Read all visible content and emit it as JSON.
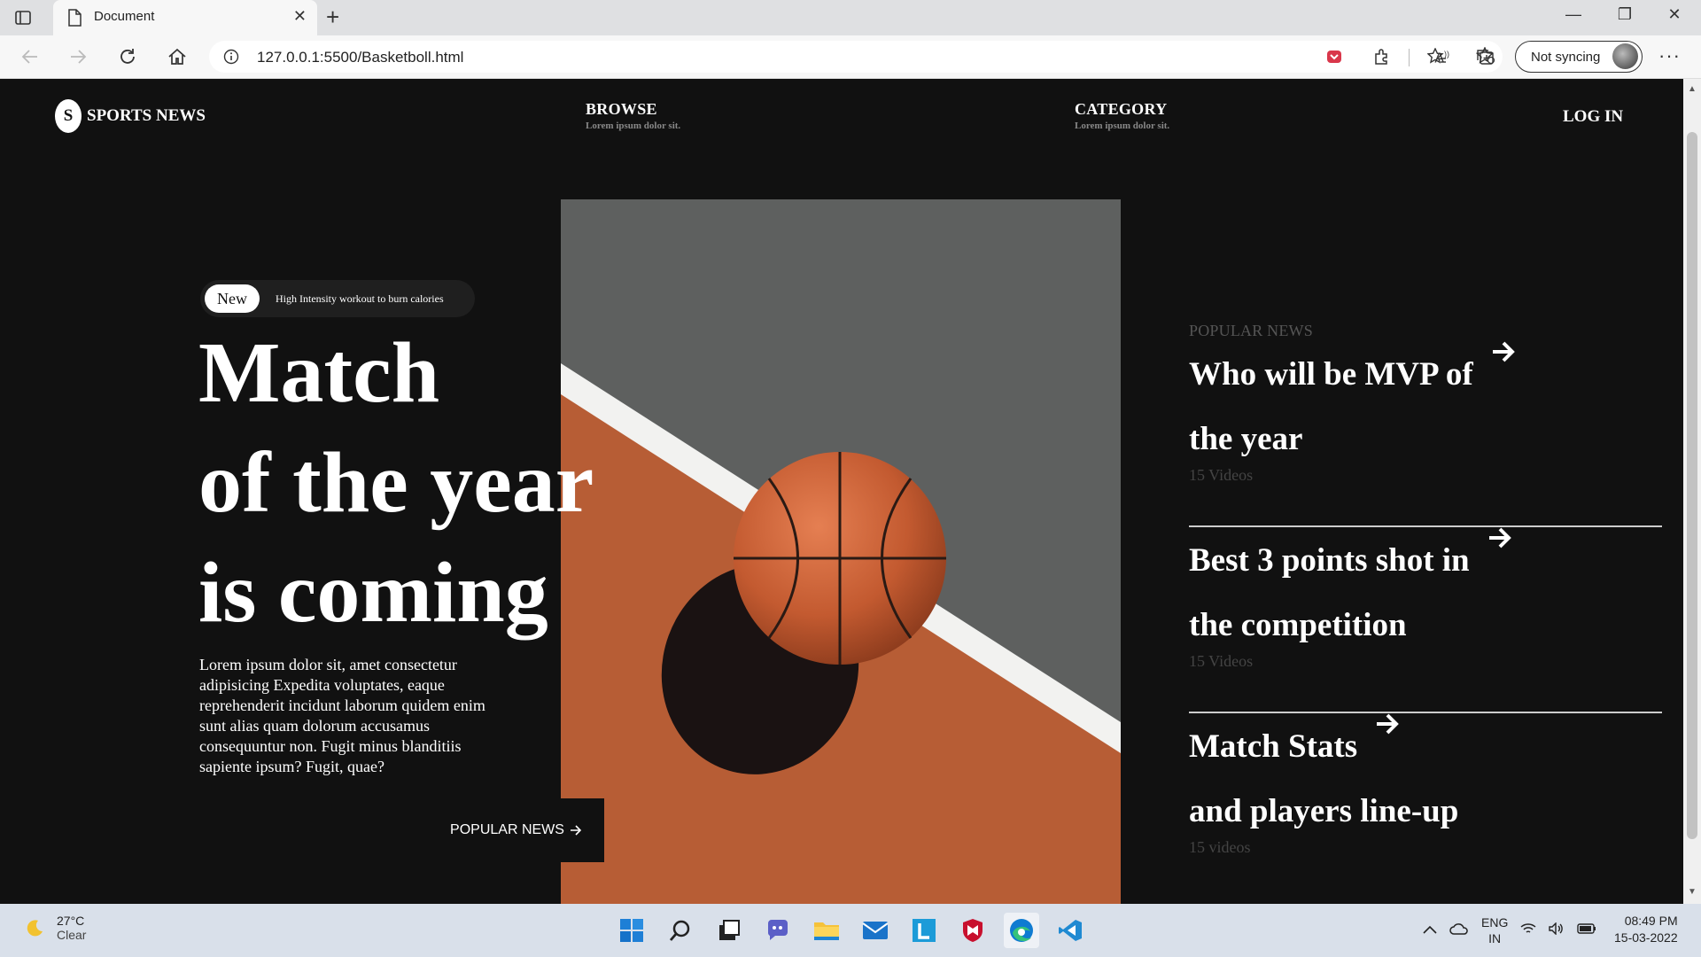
{
  "browser": {
    "tab_title": "Document",
    "url": "127.0.0.1:5500/Basketboll.html",
    "sync_label": "Not syncing"
  },
  "site": {
    "logo_letter": "S",
    "logo_text": "SPORTS NEWS",
    "nav": [
      {
        "title": "BROWSE",
        "sub": "Lorem ipsum dolor sit."
      },
      {
        "title": "CATEGORY",
        "sub": "Lorem ipsum dolor sit."
      }
    ],
    "login": "LOG IN"
  },
  "hero": {
    "badge_new": "New",
    "badge_text": "High Intensity workout to burn calories",
    "headline": [
      "Match",
      "of the year",
      "is coming"
    ],
    "lead": "Lorem ipsum dolor sit, amet consectetur adipisicing Expedita voluptates, eaque reprehenderit incidunt laborum quidem enim sunt alias quam dolorum accusamus consequuntur non. Fugit minus blanditiis sapiente ipsum? Fugit, quae?",
    "button": "POPULAR NEWS"
  },
  "popular": {
    "heading": "POPULAR NEWS",
    "items": [
      {
        "line1": "Who will be MVP of",
        "line2": "the year",
        "count": "15 Videos"
      },
      {
        "line1": "Best 3 points shot in",
        "line2": "the competition",
        "count": "15 Videos"
      },
      {
        "line1": "Match Stats",
        "line2": "and players line-up",
        "count": "15 videos"
      }
    ]
  },
  "taskbar": {
    "temp": "27°C",
    "condition": "Clear",
    "lang": "ENG",
    "region": "IN",
    "time": "08:49 PM",
    "date": "15-03-2022"
  }
}
